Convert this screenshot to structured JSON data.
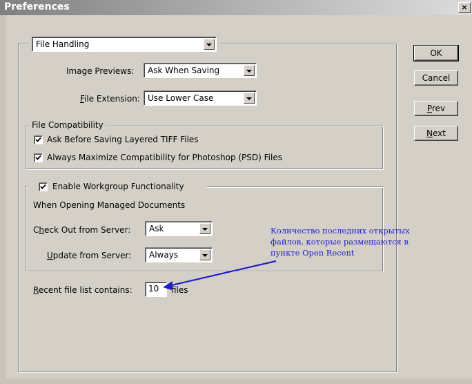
{
  "window": {
    "title": "Preferences",
    "close_label": "×"
  },
  "section_select": {
    "value": "File Handling"
  },
  "image_previews": {
    "label": "Image Previews:",
    "value": "Ask When Saving"
  },
  "file_extension": {
    "label_prefix": "",
    "label_accel": "F",
    "label_rest": "ile Extension:",
    "value": "Use Lower Case"
  },
  "file_compat": {
    "title": "File Compatibility",
    "ask_tiff": {
      "label": "Ask Before Saving Layered TIFF Files",
      "checked": true
    },
    "max_psd": {
      "label": "Always Maximize Compatibility for Photoshop (PSD) Files",
      "checked": true
    }
  },
  "workgroup": {
    "title": "Enable Workgroup Functionality",
    "checked": true,
    "subtitle": "When Opening Managed Documents",
    "check_out": {
      "label_prefix": "C",
      "label_accel": "h",
      "label_rest": "eck Out from Server:",
      "value": "Ask"
    },
    "update": {
      "label_prefix": "",
      "label_accel": "U",
      "label_rest": "pdate from Server:",
      "value": "Always"
    }
  },
  "recent": {
    "label_prefix": "",
    "label_accel": "R",
    "label_rest": "ecent file list contains:",
    "value": "10",
    "suffix": "files"
  },
  "buttons": {
    "ok": "OK",
    "cancel": "Cancel",
    "prev": {
      "accel": "P",
      "rest": "rev"
    },
    "next": {
      "accel": "N",
      "rest": "ext"
    }
  },
  "annotation": {
    "line1": "Количество последних открытых",
    "line2": "файлов, которые размещаются в",
    "line3": "пункте Open Recent",
    "color": "#2020c8"
  }
}
